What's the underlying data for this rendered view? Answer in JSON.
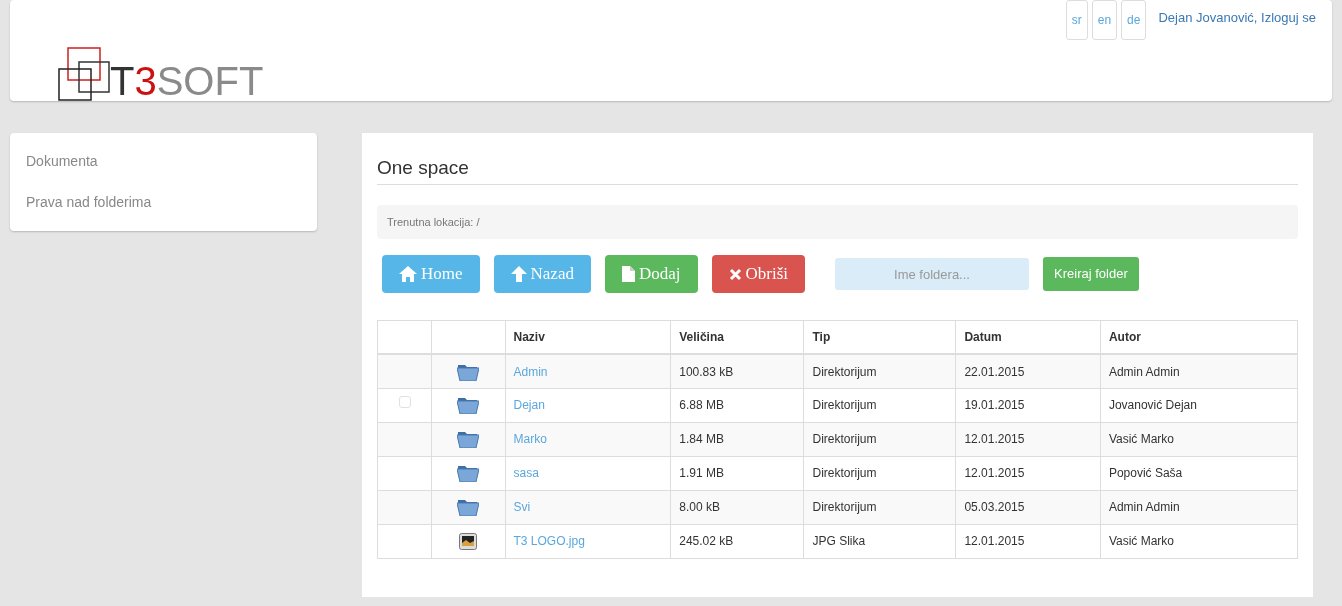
{
  "header": {
    "logo_parts": [
      {
        "text": "T",
        "color": "#333333"
      },
      {
        "text": "3",
        "color": "#cc1111"
      },
      {
        "text": "SOFT",
        "color": "#8a8a8a"
      }
    ],
    "languages": [
      {
        "label": "sr"
      },
      {
        "label": "en"
      },
      {
        "label": "de"
      }
    ],
    "user_link": "Dejan Jovanović, Izloguj se"
  },
  "sidebar": {
    "items": [
      {
        "label": "Dokumenta"
      },
      {
        "label": "Prava nad folderima"
      }
    ]
  },
  "main": {
    "title": "One space",
    "location": "Trenutna lokacija: /",
    "toolbar": [
      {
        "kind": "home",
        "label": "Home",
        "color": "#56b6e8"
      },
      {
        "kind": "up",
        "label": "Nazad",
        "color": "#56b6e8"
      },
      {
        "kind": "file",
        "label": "Dodaj",
        "color": "#5cb85c"
      },
      {
        "kind": "delete",
        "label": "Obriši",
        "color": "#d9534f"
      }
    ],
    "folder_field": {
      "placeholder": "Ime foldera..."
    },
    "create_button": "Kreiraj folder",
    "table": {
      "columns": [
        "Naziv",
        "Veličina",
        "Tip",
        "Datum",
        "Autor"
      ],
      "rows": [
        {
          "kind": "folder",
          "name": "Admin",
          "size": "100.83 kB",
          "type": "Direktorijum",
          "date": "22.01.2015",
          "author": "Admin Admin"
        },
        {
          "kind": "folder",
          "checkbox": {
            "checked": false
          },
          "name": "Dejan",
          "size": "6.88 MB",
          "type": "Direktorijum",
          "date": "19.01.2015",
          "author": "Jovanović Dejan"
        },
        {
          "kind": "folder",
          "name": "Marko",
          "size": "1.84 MB",
          "type": "Direktorijum",
          "date": "12.01.2015",
          "author": "Vasić Marko"
        },
        {
          "kind": "folder",
          "name": "sasa",
          "size": "1.91 MB",
          "type": "Direktorijum",
          "date": "12.01.2015",
          "author": "Popović Saša"
        },
        {
          "kind": "folder",
          "name": "Svi",
          "size": "8.00 kB",
          "type": "Direktorijum",
          "date": "05.03.2015",
          "author": "Admin Admin"
        },
        {
          "kind": "image",
          "name": "T3 LOGO.jpg",
          "size": "245.02 kB",
          "type": "JPG Slika",
          "date": "12.01.2015",
          "author": "Vasić Marko"
        }
      ]
    }
  }
}
